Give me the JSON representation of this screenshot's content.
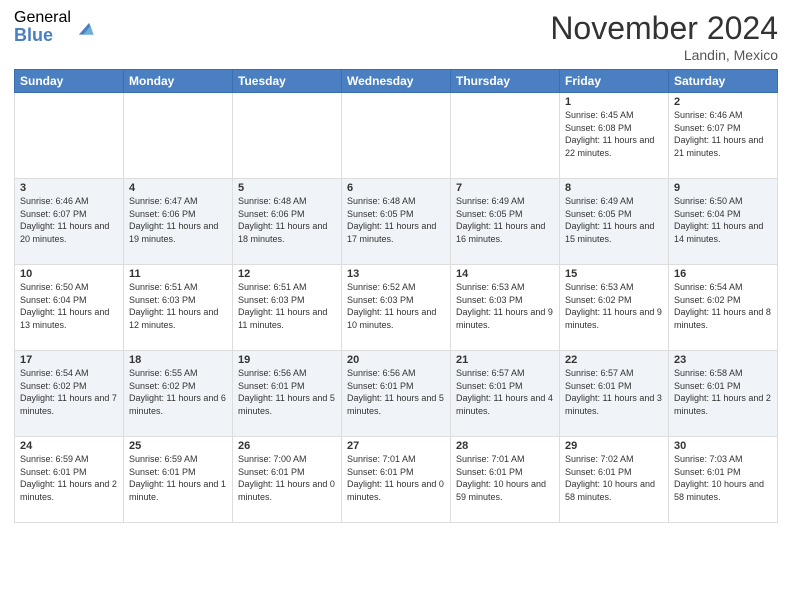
{
  "logo": {
    "general": "General",
    "blue": "Blue"
  },
  "header": {
    "month": "November 2024",
    "location": "Landin, Mexico"
  },
  "weekdays": [
    "Sunday",
    "Monday",
    "Tuesday",
    "Wednesday",
    "Thursday",
    "Friday",
    "Saturday"
  ],
  "weeks": [
    [
      {
        "day": "",
        "info": ""
      },
      {
        "day": "",
        "info": ""
      },
      {
        "day": "",
        "info": ""
      },
      {
        "day": "",
        "info": ""
      },
      {
        "day": "",
        "info": ""
      },
      {
        "day": "1",
        "info": "Sunrise: 6:45 AM\nSunset: 6:08 PM\nDaylight: 11 hours and 22 minutes."
      },
      {
        "day": "2",
        "info": "Sunrise: 6:46 AM\nSunset: 6:07 PM\nDaylight: 11 hours and 21 minutes."
      }
    ],
    [
      {
        "day": "3",
        "info": "Sunrise: 6:46 AM\nSunset: 6:07 PM\nDaylight: 11 hours and 20 minutes."
      },
      {
        "day": "4",
        "info": "Sunrise: 6:47 AM\nSunset: 6:06 PM\nDaylight: 11 hours and 19 minutes."
      },
      {
        "day": "5",
        "info": "Sunrise: 6:48 AM\nSunset: 6:06 PM\nDaylight: 11 hours and 18 minutes."
      },
      {
        "day": "6",
        "info": "Sunrise: 6:48 AM\nSunset: 6:05 PM\nDaylight: 11 hours and 17 minutes."
      },
      {
        "day": "7",
        "info": "Sunrise: 6:49 AM\nSunset: 6:05 PM\nDaylight: 11 hours and 16 minutes."
      },
      {
        "day": "8",
        "info": "Sunrise: 6:49 AM\nSunset: 6:05 PM\nDaylight: 11 hours and 15 minutes."
      },
      {
        "day": "9",
        "info": "Sunrise: 6:50 AM\nSunset: 6:04 PM\nDaylight: 11 hours and 14 minutes."
      }
    ],
    [
      {
        "day": "10",
        "info": "Sunrise: 6:50 AM\nSunset: 6:04 PM\nDaylight: 11 hours and 13 minutes."
      },
      {
        "day": "11",
        "info": "Sunrise: 6:51 AM\nSunset: 6:03 PM\nDaylight: 11 hours and 12 minutes."
      },
      {
        "day": "12",
        "info": "Sunrise: 6:51 AM\nSunset: 6:03 PM\nDaylight: 11 hours and 11 minutes."
      },
      {
        "day": "13",
        "info": "Sunrise: 6:52 AM\nSunset: 6:03 PM\nDaylight: 11 hours and 10 minutes."
      },
      {
        "day": "14",
        "info": "Sunrise: 6:53 AM\nSunset: 6:03 PM\nDaylight: 11 hours and 9 minutes."
      },
      {
        "day": "15",
        "info": "Sunrise: 6:53 AM\nSunset: 6:02 PM\nDaylight: 11 hours and 9 minutes."
      },
      {
        "day": "16",
        "info": "Sunrise: 6:54 AM\nSunset: 6:02 PM\nDaylight: 11 hours and 8 minutes."
      }
    ],
    [
      {
        "day": "17",
        "info": "Sunrise: 6:54 AM\nSunset: 6:02 PM\nDaylight: 11 hours and 7 minutes."
      },
      {
        "day": "18",
        "info": "Sunrise: 6:55 AM\nSunset: 6:02 PM\nDaylight: 11 hours and 6 minutes."
      },
      {
        "day": "19",
        "info": "Sunrise: 6:56 AM\nSunset: 6:01 PM\nDaylight: 11 hours and 5 minutes."
      },
      {
        "day": "20",
        "info": "Sunrise: 6:56 AM\nSunset: 6:01 PM\nDaylight: 11 hours and 5 minutes."
      },
      {
        "day": "21",
        "info": "Sunrise: 6:57 AM\nSunset: 6:01 PM\nDaylight: 11 hours and 4 minutes."
      },
      {
        "day": "22",
        "info": "Sunrise: 6:57 AM\nSunset: 6:01 PM\nDaylight: 11 hours and 3 minutes."
      },
      {
        "day": "23",
        "info": "Sunrise: 6:58 AM\nSunset: 6:01 PM\nDaylight: 11 hours and 2 minutes."
      }
    ],
    [
      {
        "day": "24",
        "info": "Sunrise: 6:59 AM\nSunset: 6:01 PM\nDaylight: 11 hours and 2 minutes."
      },
      {
        "day": "25",
        "info": "Sunrise: 6:59 AM\nSunset: 6:01 PM\nDaylight: 11 hours and 1 minute."
      },
      {
        "day": "26",
        "info": "Sunrise: 7:00 AM\nSunset: 6:01 PM\nDaylight: 11 hours and 0 minutes."
      },
      {
        "day": "27",
        "info": "Sunrise: 7:01 AM\nSunset: 6:01 PM\nDaylight: 11 hours and 0 minutes."
      },
      {
        "day": "28",
        "info": "Sunrise: 7:01 AM\nSunset: 6:01 PM\nDaylight: 10 hours and 59 minutes."
      },
      {
        "day": "29",
        "info": "Sunrise: 7:02 AM\nSunset: 6:01 PM\nDaylight: 10 hours and 58 minutes."
      },
      {
        "day": "30",
        "info": "Sunrise: 7:03 AM\nSunset: 6:01 PM\nDaylight: 10 hours and 58 minutes."
      }
    ]
  ]
}
